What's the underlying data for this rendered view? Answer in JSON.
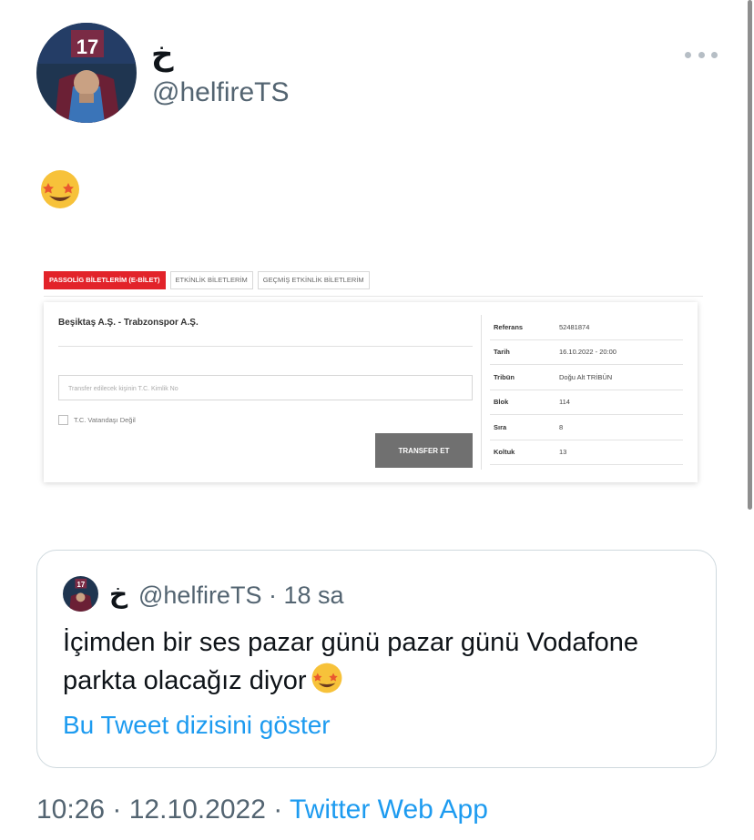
{
  "tweet": {
    "display_name": "خ",
    "handle": "@helfireTS",
    "body_emoji": "star-struck-emoji"
  },
  "ticket": {
    "tabs": [
      "PASSOLİG BİLETLERİM (E-BİLET)",
      "ETKİNLİK BİLETLERİM",
      "GEÇMİŞ ETKİNLİK BİLETLERİM"
    ],
    "match": "Beşiktaş A.Ş. - Trabzonspor A.Ş.",
    "tc_placeholder": "Transfer edilecek kişinin T.C. Kimlik No",
    "checkbox_label": "T.C. Vatandaşı Değil",
    "transfer_button": "TRANSFER ET",
    "details": [
      {
        "label": "Referans",
        "value": "52481874"
      },
      {
        "label": "Tarih",
        "value": "16.10.2022 - 20:00"
      },
      {
        "label": "Tribün",
        "value": "Doğu Alt TRİBÜN"
      },
      {
        "label": "Blok",
        "value": "114"
      },
      {
        "label": "Sıra",
        "value": "8"
      },
      {
        "label": "Koltuk",
        "value": "13"
      }
    ]
  },
  "quote": {
    "display_name": "خ",
    "handle_time": "@helfireTS · 18 sa",
    "text": "İçimden bir ses pazar günü pazar günü Vodafone parkta olacağız diyor",
    "thread_link": "Bu Tweet dizisini göster"
  },
  "footer": {
    "time_date": "10:26 · 12.10.2022 · ",
    "app": "Twitter Web App"
  },
  "colors": {
    "link": "#1d9bf0",
    "secondary_text": "#536471",
    "active_tab": "#e2232a"
  }
}
